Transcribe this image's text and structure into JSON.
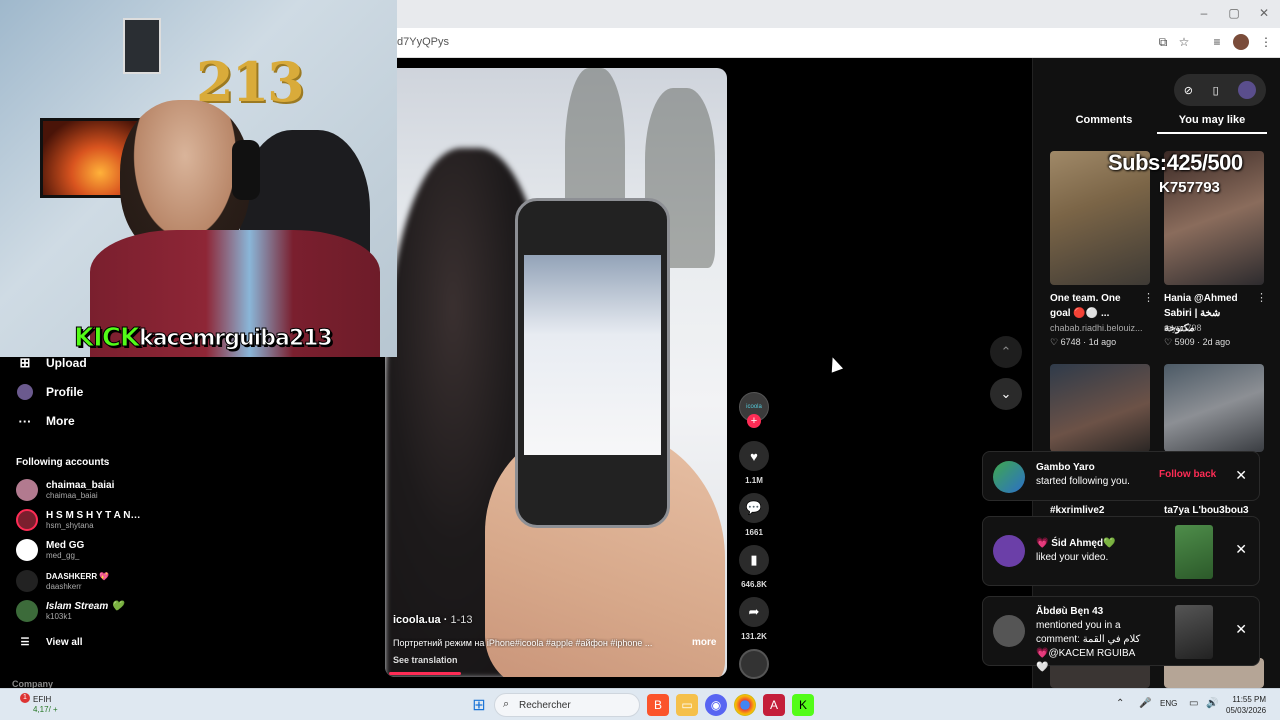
{
  "browser": {
    "url_fragment": "d7YyQPys"
  },
  "sidebar": {
    "items": [
      {
        "label": "Upload",
        "icon": "plus-box-icon"
      },
      {
        "label": "Profile",
        "icon": "avatar-icon"
      },
      {
        "label": "More",
        "icon": "more-dots-icon"
      }
    ],
    "following_title": "Following accounts",
    "accounts": [
      {
        "name": "chaimaa_baiai",
        "handle": "chaimaa_baiai"
      },
      {
        "name": "H S M S H Y T A N…",
        "handle": "hsm_shytana"
      },
      {
        "name": "Med GG",
        "handle": "med_gg_"
      },
      {
        "name": "DAASHKERR 💖",
        "handle": "daashkerr"
      },
      {
        "name": "Islam Stream 💚",
        "handle": "k103k1"
      }
    ],
    "view_all": "View all",
    "company": "Company"
  },
  "video": {
    "username": "icoola.ua",
    "date": "1-13",
    "caption": "Портретний режим на iPhone#icoola #apple #айфон #iphone ...",
    "more": "more",
    "see_translation": "See translation",
    "author_label": "icoola",
    "progress": 0.22
  },
  "actions": {
    "likes": "1.1M",
    "comments": "1661",
    "saves": "646.8K",
    "shares": "131.2K"
  },
  "right_panel": {
    "tab_comments": "Comments",
    "tab_you_may_like": "You may like",
    "thumbs": [
      {
        "title": "One team. One goal 🔴⚪ ...",
        "user": "chabab.riadhi.belouiz...",
        "likes": "6748",
        "age": "1d ago"
      },
      {
        "title": "Hania @Ahmed Sabiri | شخة مكتوخة",
        "user": "rayno798",
        "likes": "5909",
        "age": "2d ago"
      },
      {
        "title": "#kxrimlive2",
        "user": "",
        "likes": "",
        "age": ""
      },
      {
        "title": "ta7ya L'bou3bou3",
        "user": "",
        "likes": "",
        "age": ""
      }
    ]
  },
  "notifications": [
    {
      "name": "Gambo Yaro",
      "text": "started following you.",
      "action": "Follow back"
    },
    {
      "name": "💗 Śid Ahmęd💚",
      "text": "liked your video.",
      "action": ""
    },
    {
      "name": "Ăbdøù Bęn 43",
      "text": "mentioned you in a comment: كلام في القمة 💗@KACEM RGUIBA🤍",
      "action": ""
    }
  ],
  "stream_overlay": {
    "kick_logo": "KICK",
    "streamer": "kacemrguiba213",
    "subs": "Subs:425/500",
    "code": "K757793",
    "balloons": "213"
  },
  "taskbar": {
    "weather_name": "EFIH",
    "weather_value": "4,17/ +",
    "weather_badge": "1",
    "search_placeholder": "Rechercher",
    "lang": "ENG",
    "time": "11:55 PM",
    "date": "05/03/2026"
  },
  "colors": {
    "accent": "#fe2c55",
    "kick_green": "#53fc18",
    "background": "#000000"
  }
}
